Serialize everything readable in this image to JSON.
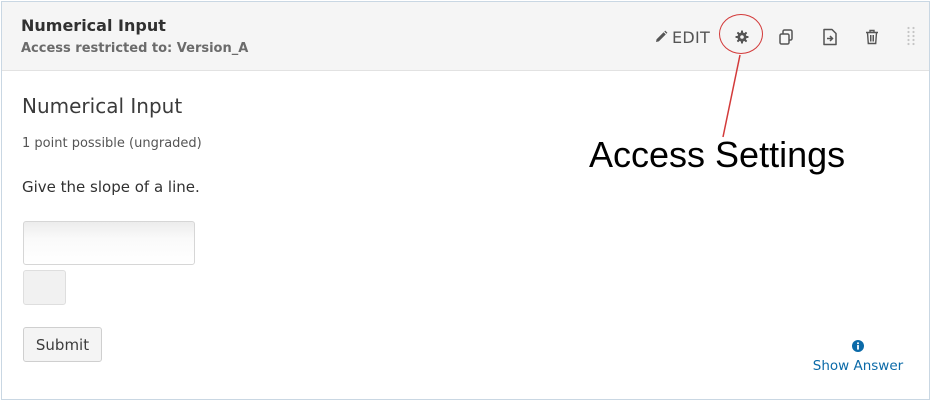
{
  "header": {
    "title": "Numerical Input",
    "access_text": "Access restricted to: Version_A",
    "edit_label": "EDIT",
    "icons": [
      "pencil-icon",
      "gear-icon",
      "duplicate-icon",
      "move-icon",
      "trash-icon",
      "drag-handle-icon"
    ]
  },
  "annotation": {
    "label": "Access Settings",
    "color": "#d33a3a"
  },
  "problem": {
    "title": "Numerical Input",
    "points": "1 point possible (ungraded)",
    "question": "Give the slope of a line.",
    "answer_value": "",
    "submit_label": "Submit",
    "show_answer_label": "Show Answer"
  },
  "colors": {
    "link": "#0b6aa8",
    "border": "#c9d7e3",
    "header_bg": "#f5f5f5"
  }
}
